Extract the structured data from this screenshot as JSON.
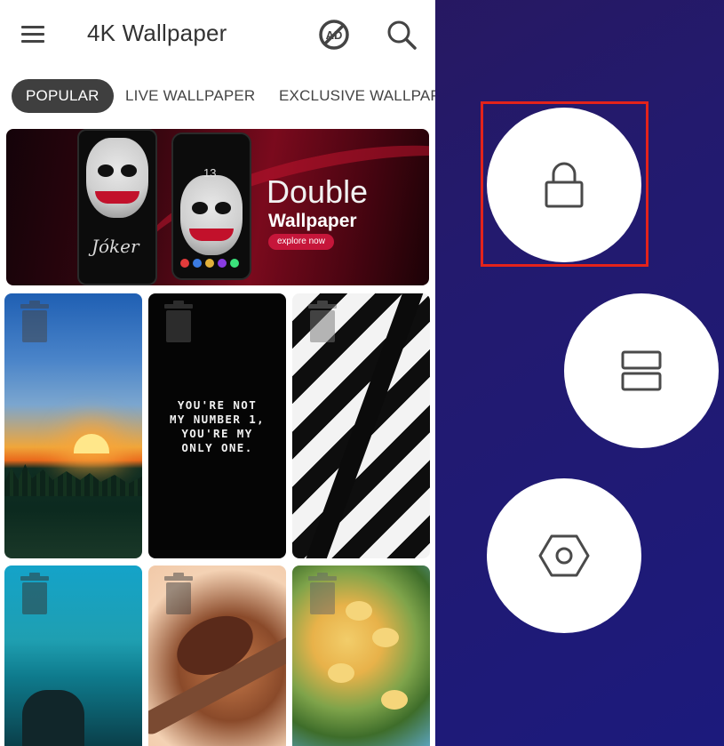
{
  "app": {
    "title": "4K Wallpaper",
    "tabs": [
      {
        "label": "POPULAR",
        "active": true
      },
      {
        "label": "LIVE WALLPAPER",
        "active": false
      },
      {
        "label": "EXCLUSIVE WALLPAPER",
        "active": false
      }
    ]
  },
  "banner": {
    "title": "Double",
    "subtitle": "Wallpaper",
    "cta": "explore now",
    "phone_clock": "13",
    "phone_logo_text": "Jóker"
  },
  "wallpapers": [
    {
      "name": "sunset-landscape",
      "quote": ""
    },
    {
      "name": "quote-black",
      "quote": "YOU'RE NOT\nMY NUMBER 1,\nYOU'RE MY\nONLY ONE."
    },
    {
      "name": "black-white-stripes",
      "quote": ""
    },
    {
      "name": "ocean-rock",
      "quote": ""
    },
    {
      "name": "ant-macro",
      "quote": ""
    },
    {
      "name": "yellow-flowers",
      "quote": ""
    }
  ],
  "actions": [
    {
      "icon": "lock-icon",
      "highlighted": true
    },
    {
      "icon": "split-layout-icon",
      "highlighted": false
    },
    {
      "icon": "hexagon-settings-icon",
      "highlighted": false
    }
  ],
  "colors": {
    "highlight": "#e3231b",
    "active_tab_bg": "#3f3f3f",
    "background": "#231a6e"
  }
}
